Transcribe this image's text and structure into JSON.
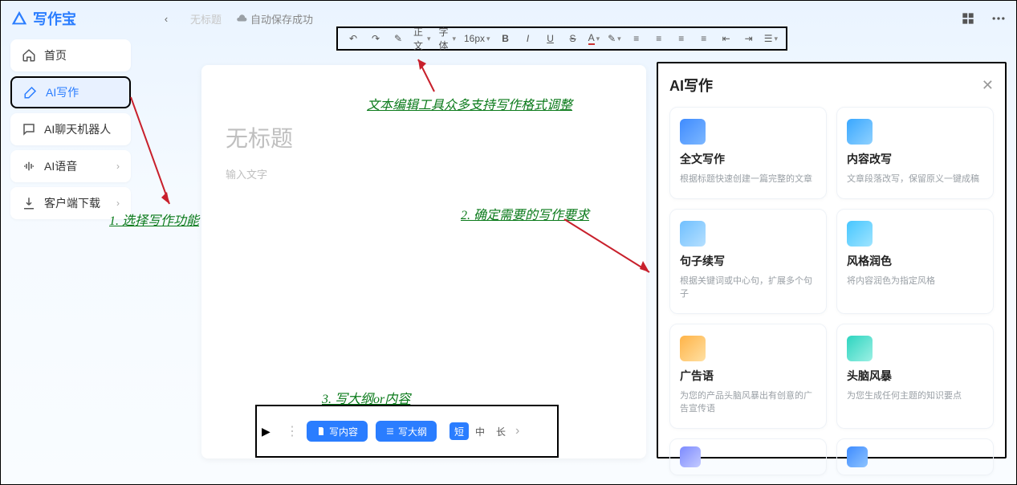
{
  "app": {
    "name": "写作宝"
  },
  "header": {
    "tab": "无标题",
    "autosave": "自动保存成功"
  },
  "sidebar": {
    "items": [
      {
        "label": "首页",
        "icon": "home-icon"
      },
      {
        "label": "AI写作",
        "icon": "pencil-icon",
        "active": true
      },
      {
        "label": "AI聊天机器人",
        "icon": "chat-icon"
      },
      {
        "label": "AI语音",
        "icon": "sound-icon",
        "chevron": true
      },
      {
        "label": "客户端下载",
        "icon": "download-icon",
        "chevron": true
      }
    ]
  },
  "toolbar": {
    "select_style": "正文",
    "select_font": "字体",
    "select_size": "16px",
    "bold": "B",
    "italic": "I",
    "underline": "U",
    "strike": "S"
  },
  "editor": {
    "title_placeholder": "无标题",
    "body_placeholder": "输入文字"
  },
  "bottom": {
    "write_content": "写内容",
    "write_outline": "写大纲",
    "len_short": "短",
    "len_mid": "中",
    "len_long": "长"
  },
  "ai_panel": {
    "title": "AI写作",
    "cards": [
      {
        "title": "全文写作",
        "desc": "根据标题快速创建一篇完整的文章",
        "color": "#3e8bff"
      },
      {
        "title": "内容改写",
        "desc": "文章段落改写，保留原义一键成稿",
        "color": "#39a7ff"
      },
      {
        "title": "句子续写",
        "desc": "根据关键词或中心句，扩展多个句子",
        "color": "#6fbfff"
      },
      {
        "title": "风格润色",
        "desc": "将内容润色为指定风格",
        "color": "#46c6ff"
      },
      {
        "title": "广告语",
        "desc": "为您的产品头脑风暴出有创意的广告宣传语",
        "color": "#ffb347"
      },
      {
        "title": "头脑风暴",
        "desc": "为您生成任何主题的知识要点",
        "color": "#2dd4bf"
      }
    ]
  },
  "annotations": {
    "step1": "1. 选择写作功能",
    "tip_editor": "文本编辑工具众多支持写作格式调整",
    "step2": "2. 确定需要的写作要求",
    "step3": "3. 写大纲or内容"
  }
}
